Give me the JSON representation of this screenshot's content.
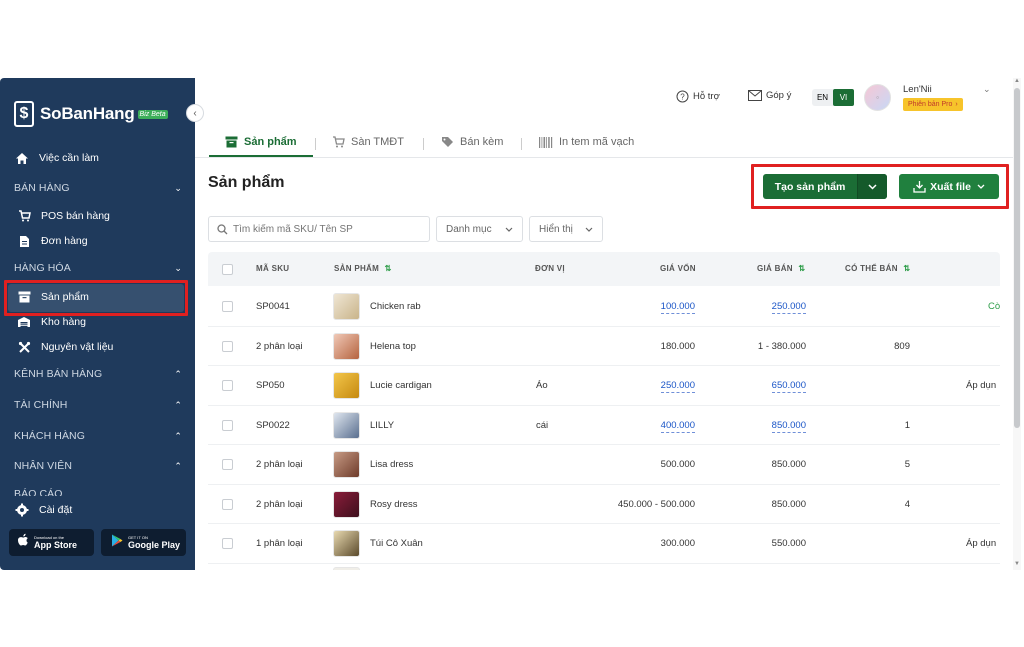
{
  "sidebar": {
    "logo_text": "SoBanHang",
    "logo_badge": "Biz Beta",
    "items": {
      "todo": "Việc cần làm",
      "group_sales": "BÁN HÀNG",
      "pos": "POS bán hàng",
      "orders": "Đơn hàng",
      "group_goods": "HÀNG HÓA",
      "products": "Sản phẩm",
      "warehouse": "Kho hàng",
      "materials": "Nguyên vật liệu",
      "group_channels": "KÊNH BÁN HÀNG",
      "group_finance": "TÀI CHÍNH",
      "group_customers": "KHÁCH HÀNG",
      "group_staff": "NHÂN VIÊN",
      "group_reports": "BÁO CÁO",
      "settings": "Cài đặt"
    },
    "appstore_small": "Download on the",
    "appstore": "App Store",
    "googleplay_small": "GET IT ON",
    "googleplay": "Google Play"
  },
  "topbar": {
    "help": "Hỗ trợ",
    "feedback": "Góp ý",
    "lang_en": "EN",
    "lang_vi": "VI",
    "user_name": "Len'Nii",
    "pro_badge": "Phiên bản Pro"
  },
  "tabs": {
    "products": "Sản phẩm",
    "ecommerce": "Sàn TMĐT",
    "bundles": "Bán kèm",
    "barcode": "In tem mã vạch"
  },
  "page_title": "Sản phẩm",
  "actions": {
    "create": "Tạo sản phẩm",
    "export": "Xuất file"
  },
  "filters": {
    "search_placeholder": "Tìm kiếm mã SKU/ Tên SP",
    "category": "Danh mục",
    "display": "Hiển thị"
  },
  "table": {
    "headers": {
      "sku": "MÃ SKU",
      "product": "SẢN PHẨM",
      "unit": "ĐƠN VỊ",
      "cost": "GIÁ VỐN",
      "price": "GIÁ BÁN",
      "available": "CÓ THỂ BÁN"
    },
    "rows": [
      {
        "sku": "SP0041",
        "name": "Chicken rab",
        "unit": "",
        "cost": "100.000",
        "price": "250.000",
        "available": "",
        "extra": "Cò"
      },
      {
        "sku": "2 phân loại",
        "name": "Helena top",
        "unit": "",
        "cost": "180.000",
        "price": "1 - 380.000",
        "available": "809",
        "extra": ""
      },
      {
        "sku": "SP050",
        "name": "Lucie cardigan",
        "unit": "Áo",
        "cost": "250.000",
        "price": "650.000",
        "available": "",
        "extra": "Áp dụn"
      },
      {
        "sku": "SP0022",
        "name": "LILLY",
        "unit": "cái",
        "cost": "400.000",
        "price": "850.000",
        "available": "1",
        "extra": ""
      },
      {
        "sku": "2 phân loại",
        "name": "Lisa dress",
        "unit": "",
        "cost": "500.000",
        "price": "850.000",
        "available": "5",
        "extra": ""
      },
      {
        "sku": "2 phân loại",
        "name": "Rosy dress",
        "unit": "",
        "cost": "450.000 - 500.000",
        "price": "850.000",
        "available": "4",
        "extra": ""
      },
      {
        "sku": "1 phân loại",
        "name": "Túi Cô Xuân",
        "unit": "",
        "cost": "300.000",
        "price": "550.000",
        "available": "",
        "extra": "Áp dụn"
      }
    ]
  },
  "colors": {
    "sidebar_bg": "#1f3a5c",
    "brand_green": "#1b6d35",
    "highlight_red": "#e02020",
    "link_blue": "#1a55c7"
  }
}
